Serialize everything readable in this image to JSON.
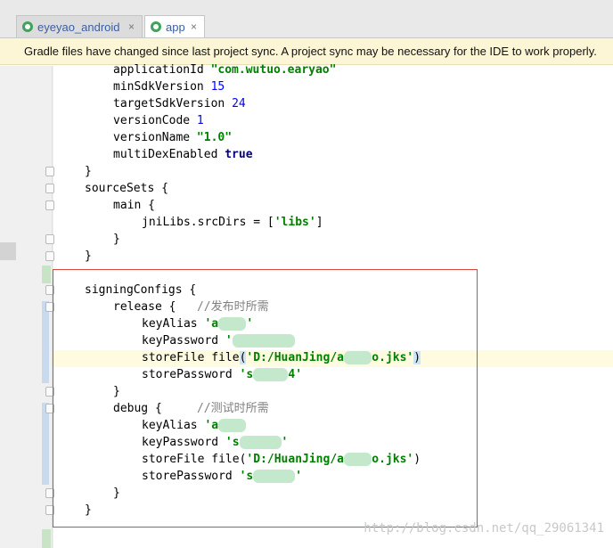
{
  "tabs": [
    {
      "label": "eyeyao_android",
      "close": "×",
      "active": false
    },
    {
      "label": "app",
      "close": "×",
      "active": true
    }
  ],
  "banner": "Gradle files have changed since last project sync. A project sync may be necessary for the IDE to work properly.",
  "code": {
    "applicationId_key": "applicationId",
    "applicationId_val": "\"com.wutuo.earyao\"",
    "minSdk_key": "minSdkVersion",
    "minSdk_val": "15",
    "targetSdk_key": "targetSdkVersion",
    "targetSdk_val": "24",
    "versionCode_key": "versionCode",
    "versionCode_val": "1",
    "versionName_key": "versionName",
    "versionName_val": "\"1.0\"",
    "multiDex_key": "multiDexEnabled",
    "multiDex_val": "true",
    "close1": "}",
    "sourceSets": "sourceSets {",
    "main": "main {",
    "jniLibs_key": "jniLibs.srcDirs = [",
    "jniLibs_val": "'libs'",
    "jniLibs_end": "]",
    "close2": "}",
    "close3": "}",
    "signingConfigs": "signingConfigs {",
    "release": "release {",
    "release_comment": "//发布时所需",
    "keyAlias_label": "keyAlias",
    "keyAlias_r_a": "'a",
    "keyAlias_r_blur": "xxxx",
    "keyAlias_r_b": "'",
    "keyPassword_label": "keyPassword",
    "keyPassword_r_a": "'",
    "keyPassword_r_blur": "xxxxxxxxx",
    "storeFile_label": "storeFile file",
    "storeFile_r_a": "'D:/HuanJing/a",
    "storeFile_r_blur": "xxxx",
    "storeFile_r_b": "o.jks'",
    "storePassword_label": "storePassword",
    "storePassword_r_a": "'s",
    "storePassword_r_blur": "xxxxx",
    "storePassword_r_b": "4'",
    "close4": "}",
    "debug": "debug {",
    "debug_comment": "//测试时所需",
    "keyAlias_d_a": "'a",
    "keyAlias_d_blur": "xxxx",
    "keyPassword_d_a": "'s",
    "keyPassword_d_blur": "xxxxxx",
    "keyPassword_d_b": "'",
    "storeFile_d_a": "'D:/HuanJing/a",
    "storeFile_d_blur": "xxxx",
    "storeFile_d_b": "o.jks'",
    "storePassword_d_a": "'s",
    "storePassword_d_blur": "xxxxxx",
    "storePassword_d_b": "'",
    "close5": "}",
    "close6": "}"
  },
  "watermark": "http://blog.csdn.net/qq_29061341",
  "colors": {
    "banner_bg": "#fcf6d6",
    "selection_border": "#d9473f",
    "keyword": "#000080",
    "string": "#008000",
    "number": "#0000ff"
  }
}
